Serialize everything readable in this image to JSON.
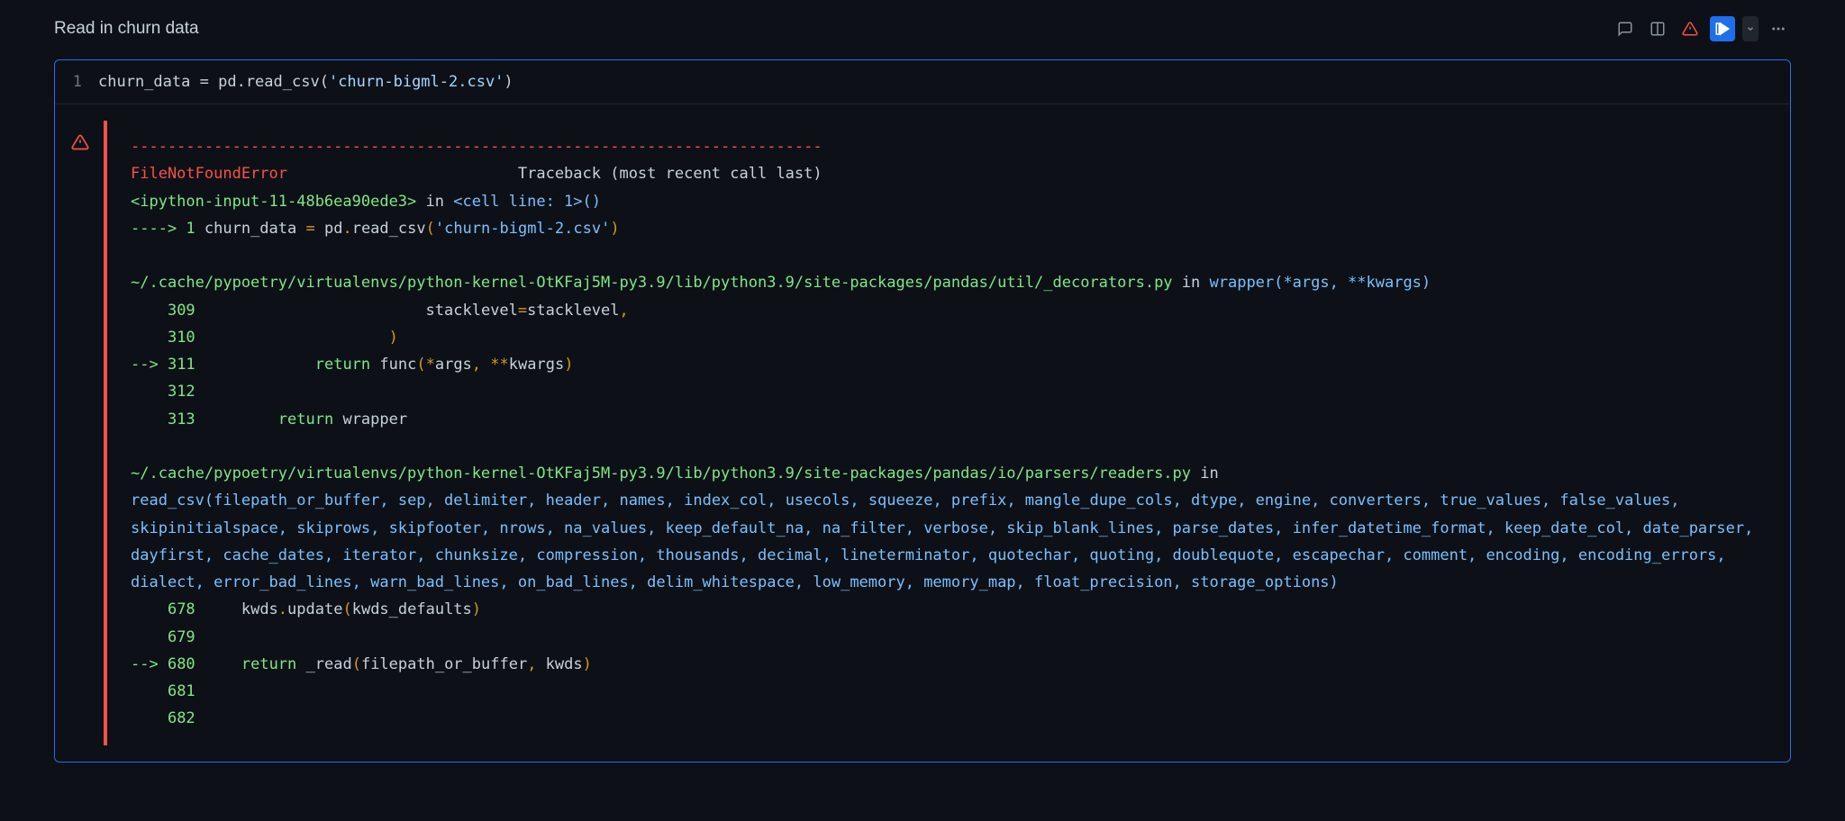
{
  "markdown": {
    "text": "Read in churn data"
  },
  "code": {
    "line_number": "1",
    "prefix": "churn_data ",
    "eq": "=",
    "pd": " pd",
    "dot": ".",
    "fn": "read_csv",
    "lparen": "(",
    "str": "'churn-bigml-2.csv'",
    "rparen": ")"
  },
  "trace": {
    "divider": "---------------------------------------------------------------------------",
    "err_name": "FileNotFoundError",
    "err_spacer": "                         ",
    "tb_label": "Traceback (most recent call last)",
    "ipy_open": "<ipython-input-11-48b6ea90ede3>",
    "in1": " in ",
    "cell_line": "<cell line: 1>",
    "parens1": "()",
    "arrow1": "----> 1",
    "l1_a": " churn_data ",
    "l1_eq": "=",
    "l1_pd": " pd",
    "l1_dot": ".",
    "l1_fn": "read_csv",
    "l1_lp": "(",
    "l1_str": "'churn-bigml-2.csv'",
    "l1_rp": ")",
    "path1": "~/.cache/pypoetry/virtualenvs/python-kernel-OtKFaj5M-py3.9/lib/python3.9/site-packages/pandas/util/_decorators.py",
    "in2": " in ",
    "wrapper": "wrapper",
    "args1": "(*args, **kwargs)",
    "ln309": "    309",
    "ln309_body_a": "                         stacklevel",
    "ln309_eq": "=",
    "ln309_body_b": "stacklevel",
    "ln309_comma": ",",
    "ln310": "    310",
    "ln310_body": "                     )",
    "arrow311": "--> ",
    "ln311": "311",
    "ln311_pad": "             ",
    "ln311_ret": "return",
    "ln311_sp": " func",
    "ln311_lp": "(",
    "ln311_star": "*",
    "ln311_args": "args",
    "ln311_c1": ",",
    "ln311_sp2": " ",
    "ln311_dstar": "**",
    "ln311_kwargs": "kwargs",
    "ln311_rp": ")",
    "ln312": "    312",
    "ln313": "    313",
    "ln313_pad": "         ",
    "ln313_ret": "return",
    "ln313_wr": " wrapper",
    "path2": "~/.cache/pypoetry/virtualenvs/python-kernel-OtKFaj5M-py3.9/lib/python3.9/site-packages/pandas/io/parsers/readers.py",
    "in3": " in ",
    "read_csv": "read_csv",
    "sig_open": "(",
    "sig_body": "filepath_or_buffer, sep, delimiter, header, names, index_col, usecols, squeeze, prefix, mangle_dupe_cols, dtype, engine, converters, true_values, false_values, skipinitialspace, skiprows, skipfooter, nrows, na_values, keep_default_na, na_filter, verbose, skip_blank_lines, parse_dates, infer_datetime_format, keep_date_col, date_parser, dayfirst, cache_dates, iterator, chunksize, compression, thousands, decimal, lineterminator, quotechar, quoting, doublequote, escapechar, comment, encoding, encoding_errors, dialect, error_bad_lines, warn_bad_lines, on_bad_lines, delim_whitespace, low_memory, memory_map, float_precision, storage_options",
    "sig_close": ")",
    "ln678": "    678",
    "ln678_pad": "     kwds",
    "ln678_dot": ".",
    "ln678_upd": "update",
    "ln678_lp": "(",
    "ln678_arg": "kwds_defaults",
    "ln678_rp": ")",
    "ln679": "    679",
    "arrow680": "--> ",
    "ln680": "680",
    "ln680_pad": "     ",
    "ln680_ret": "return",
    "ln680_sp": " _read",
    "ln680_lp": "(",
    "ln680_a1": "filepath_or_buffer",
    "ln680_c": ",",
    "ln680_a2": " kwds",
    "ln680_rp": ")",
    "ln681": "    681",
    "ln682": "    682"
  }
}
